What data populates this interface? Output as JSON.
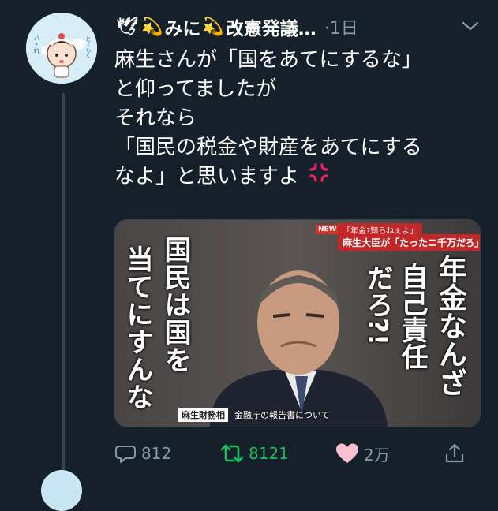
{
  "tweet": {
    "author": {
      "name_part1": "みに",
      "name_part2": "改憲発議…",
      "emoji_dove": "🕊",
      "emoji_dizzy": "💫",
      "avatar_icon": "anime-character-avatar",
      "avatar_text_left": "ハ・れ",
      "avatar_text_right": "とーもく"
    },
    "time": "·1日",
    "text_lines": [
      "麻生さんが「国をあてにするな」",
      "と仰ってましたが",
      "それなら",
      "「国民の税金や財産をあてにする",
      "なよ」と思いますよ"
    ],
    "trailing_emoji_icon": "anger-symbol-icon",
    "media": {
      "badge_new": "NEW",
      "caption_top": "「年金?知らねぇよ」",
      "caption_main": "麻生大臣が「たったニ千万だろ」",
      "left_col1": "国民は国を",
      "left_col2": "当てにすんな",
      "right_col1": "年金なんざ",
      "right_col2": "自己責任",
      "right_col3": "だろ?!",
      "bottom_tag": "麻生財務相",
      "bottom_text": "金融庁の報告書について"
    },
    "actions": {
      "reply_count": "812",
      "retweet_count": "8121",
      "like_count": "2万"
    },
    "colors": {
      "background": "#15202b",
      "muted": "#8899a6",
      "retweet_active": "#17bf63",
      "like_pink": "#f7c1cf"
    }
  }
}
